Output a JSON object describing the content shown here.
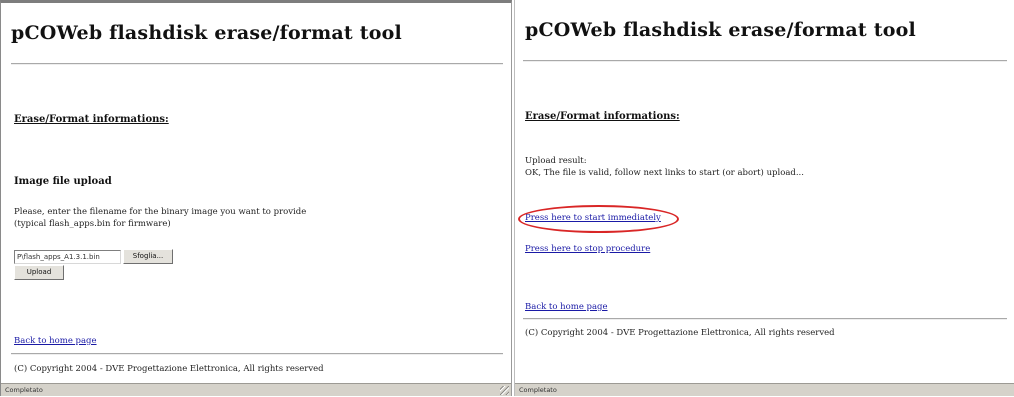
{
  "left": {
    "title": "pCOWeb flashdisk erase/format tool",
    "section_heading": "Erase/Format informations:",
    "upload_heading": "Image file upload",
    "instructions_line1": "Please, enter the filename for the binary image you want to provide",
    "instructions_line2": "(typical flash_apps.bin for firmware)",
    "file_value": "P\\flash_apps_A1.3.1.bin",
    "browse_label": "Sfoglia...",
    "upload_label": "Upload",
    "back_link": "Back to home page",
    "copyright": "(C) Copyright 2004 - DVE Progettazione Elettronica, All rights reserved",
    "status": "Completato"
  },
  "right": {
    "title": "pCOWeb flashdisk erase/format tool",
    "section_heading": "Erase/Format informations:",
    "result_label": "Upload result:",
    "result_message": "OK, The file is valid, follow next links to start (or abort) upload...",
    "start_link": "Press here to start immediately",
    "stop_link": "Press here to stop procedure",
    "back_link": "Back to home page",
    "copyright": "(C) Copyright 2004 - DVE Progettazione Elettronica, All rights reserved",
    "status": "Completato"
  },
  "colors": {
    "link": "#1a1aa6",
    "highlight_circle": "#d92626",
    "statusbar": "#d5d2ca"
  }
}
